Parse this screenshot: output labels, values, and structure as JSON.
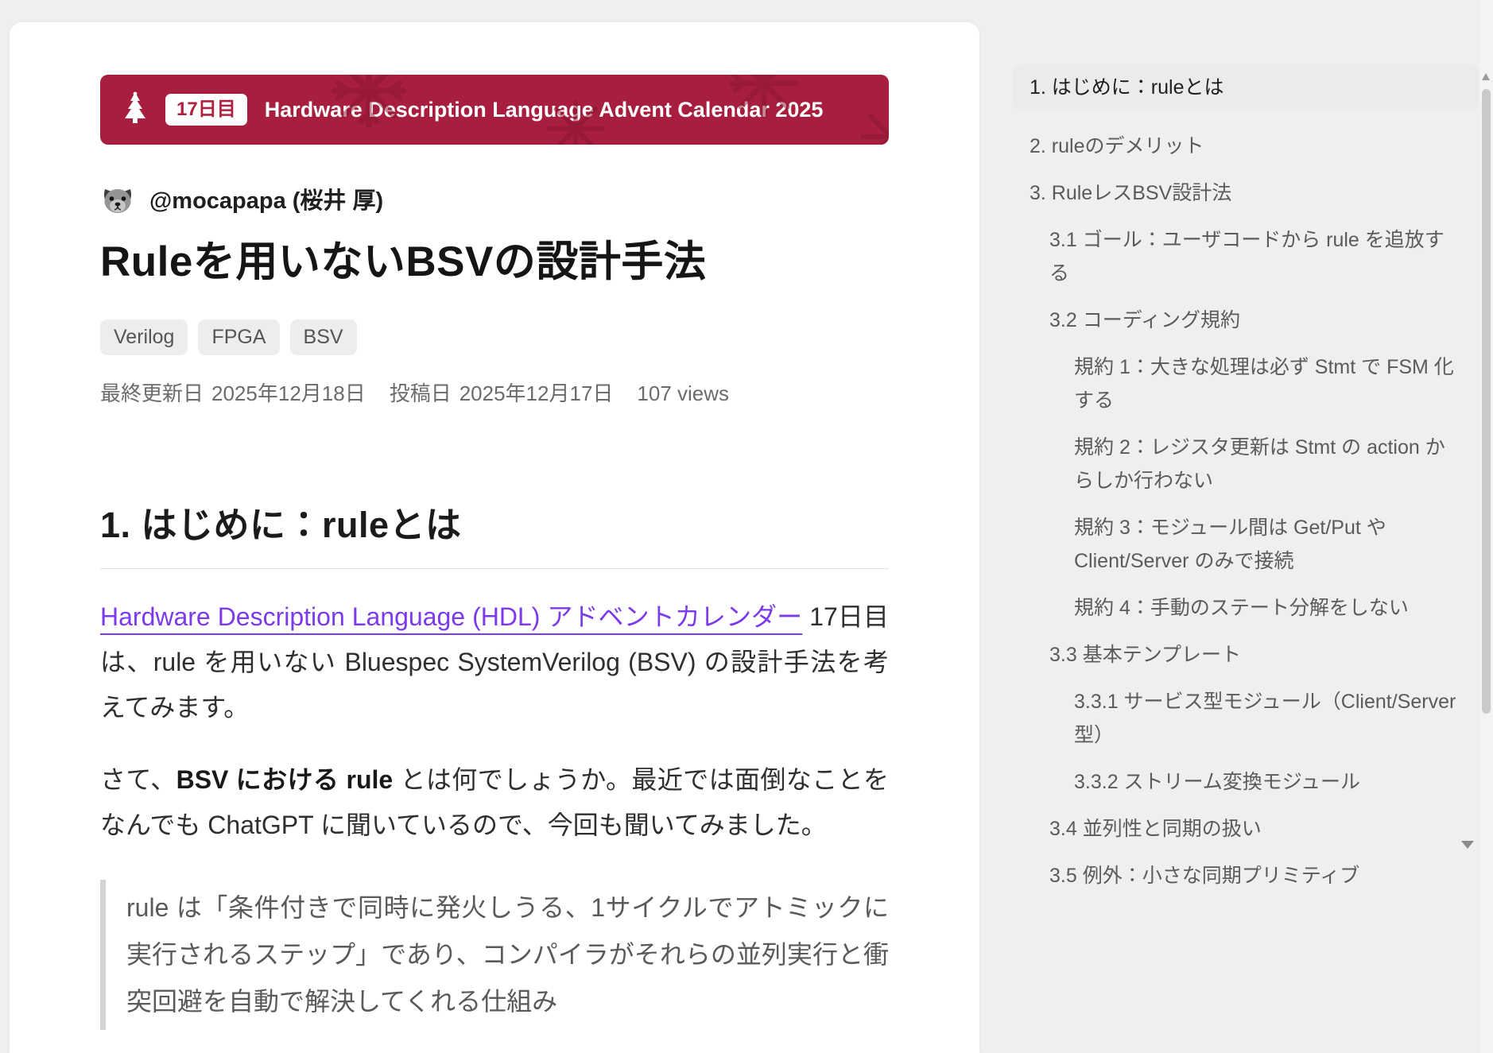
{
  "banner": {
    "day_badge": "17日目",
    "title": "Hardware Description Language Advent Calendar 2025"
  },
  "author": {
    "name": "@mocapapa (桜井 厚)"
  },
  "article": {
    "title": "Ruleを用いないBSVの設計手法",
    "tags": [
      "Verilog",
      "FPGA",
      "BSV"
    ],
    "meta": {
      "updated_label": "最終更新日",
      "updated_date": "2025年12月18日",
      "posted_label": "投稿日",
      "posted_date": "2025年12月17日",
      "views": "107 views"
    },
    "section_heading": "1. はじめに：ruleとは",
    "paragraph1": {
      "link_text": "Hardware Description Language (HDL) アドベントカレンダー",
      "rest": " 17日目は、rule を用いない Bluespec SystemVerilog (BSV) の設計手法を考えてみます。"
    },
    "paragraph2": {
      "before": "さて、",
      "bold": "BSV における rule",
      "after": " とは何でしょうか。最近では面倒なことをなんでも ChatGPT に聞いているので、今回も聞いてみました。"
    },
    "quote": "rule は「条件付きで同時に発火しうる、1サイクルでアトミックに実行されるステップ」であり、コンパイラがそれらの並列実行と衝突回避を自動で解決してくれる仕組み"
  },
  "toc": {
    "items": [
      {
        "level": 1,
        "label": "1. はじめに：ruleとは",
        "active": true
      },
      {
        "level": 1,
        "label": "2. ruleのデメリット",
        "active": false
      },
      {
        "level": 1,
        "label": "3. RuleレスBSV設計法",
        "active": false
      },
      {
        "level": 2,
        "label": "3.1 ゴール：ユーザコードから rule を追放する",
        "active": false
      },
      {
        "level": 2,
        "label": "3.2 コーディング規約",
        "active": false
      },
      {
        "level": 3,
        "label": "規約 1：大きな処理は必ず Stmt で FSM 化する",
        "active": false
      },
      {
        "level": 3,
        "label": "規約 2：レジスタ更新は Stmt の action からしか行わない",
        "active": false
      },
      {
        "level": 3,
        "label": "規約 3：モジュール間は Get/Put や Client/Server のみで接続",
        "active": false
      },
      {
        "level": 3,
        "label": "規約 4：手動のステート分解をしない",
        "active": false
      },
      {
        "level": 2,
        "label": "3.3 基本テンプレート",
        "active": false
      },
      {
        "level": 3,
        "label": "3.3.1 サービス型モジュール（Client/Server型）",
        "active": false
      },
      {
        "level": 3,
        "label": "3.3.2 ストリーム変換モジュール",
        "active": false
      },
      {
        "level": 2,
        "label": "3.4 並列性と同期の扱い",
        "active": false
      },
      {
        "level": 2,
        "label": "3.5 例外：小さな同期プリミティブ",
        "active": false
      }
    ]
  },
  "colors": {
    "banner_bg": "#a81e3e",
    "banner_flake": "#8a1630",
    "badge_text": "#b22040",
    "link": "#7c3aed",
    "active_toc_bg": "#ebebeb"
  }
}
